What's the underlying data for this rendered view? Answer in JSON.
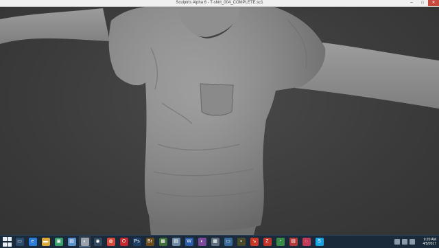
{
  "window": {
    "title": "Sculptris Alpha 6 - T-shirt_004_COMPLETE.sc1",
    "min": "–",
    "max": "□",
    "close": "✕"
  },
  "taskbar": {
    "start_icon": "windows-logo",
    "apps": [
      {
        "name": "desktop",
        "glyph": "▭",
        "color": "#2c4a6a"
      },
      {
        "name": "internet-explorer",
        "glyph": "e",
        "color": "#2b7bd6"
      },
      {
        "name": "file-explorer",
        "glyph": "▬",
        "color": "#d9a93a"
      },
      {
        "name": "photo-viewer",
        "glyph": "▣",
        "color": "#3a9f6b"
      },
      {
        "name": "picture-manager",
        "glyph": "▤",
        "color": "#5a8fc7"
      },
      {
        "name": "sculptris",
        "glyph": "◐",
        "color": "#9aa3ad"
      },
      {
        "name": "steam",
        "glyph": "◉",
        "color": "#30495f"
      },
      {
        "name": "chrome",
        "glyph": "◍",
        "color": "#d24a3a"
      },
      {
        "name": "opera",
        "glyph": "O",
        "color": "#c6262e"
      },
      {
        "name": "photoshop",
        "glyph": "Ps",
        "color": "#1c3f66"
      },
      {
        "name": "bridge",
        "glyph": "Br",
        "color": "#6b4a1a"
      },
      {
        "name": "illustrator",
        "glyph": "▦",
        "color": "#3f6e3a"
      },
      {
        "name": "notepad",
        "glyph": "▤",
        "color": "#6f8aa3"
      },
      {
        "name": "word",
        "glyph": "W",
        "color": "#2a5ea8"
      },
      {
        "name": "media-player",
        "glyph": "◐",
        "color": "#7a4a9a"
      },
      {
        "name": "calculator",
        "glyph": "▦",
        "color": "#5f6f7f"
      },
      {
        "name": "monitor-app",
        "glyph": "▭",
        "color": "#3a6a9a"
      },
      {
        "name": "terminal",
        "glyph": "▪",
        "color": "#4a4a2a"
      },
      {
        "name": "shortcut-tool",
        "glyph": "↘",
        "color": "#c93a2a"
      },
      {
        "name": "filezilla",
        "glyph": "Z",
        "color": "#c2352a"
      },
      {
        "name": "color-tool",
        "glyph": "◔",
        "color": "#3a8a4a"
      },
      {
        "name": "pdf-reader",
        "glyph": "▤",
        "color": "#b63a3a"
      },
      {
        "name": "cleaner",
        "glyph": "◌",
        "color": "#c23a5a"
      },
      {
        "name": "skype",
        "glyph": "S",
        "color": "#1aa3e0"
      }
    ],
    "clock": {
      "time": "9:20 AM",
      "date": "4/5/2017"
    }
  }
}
